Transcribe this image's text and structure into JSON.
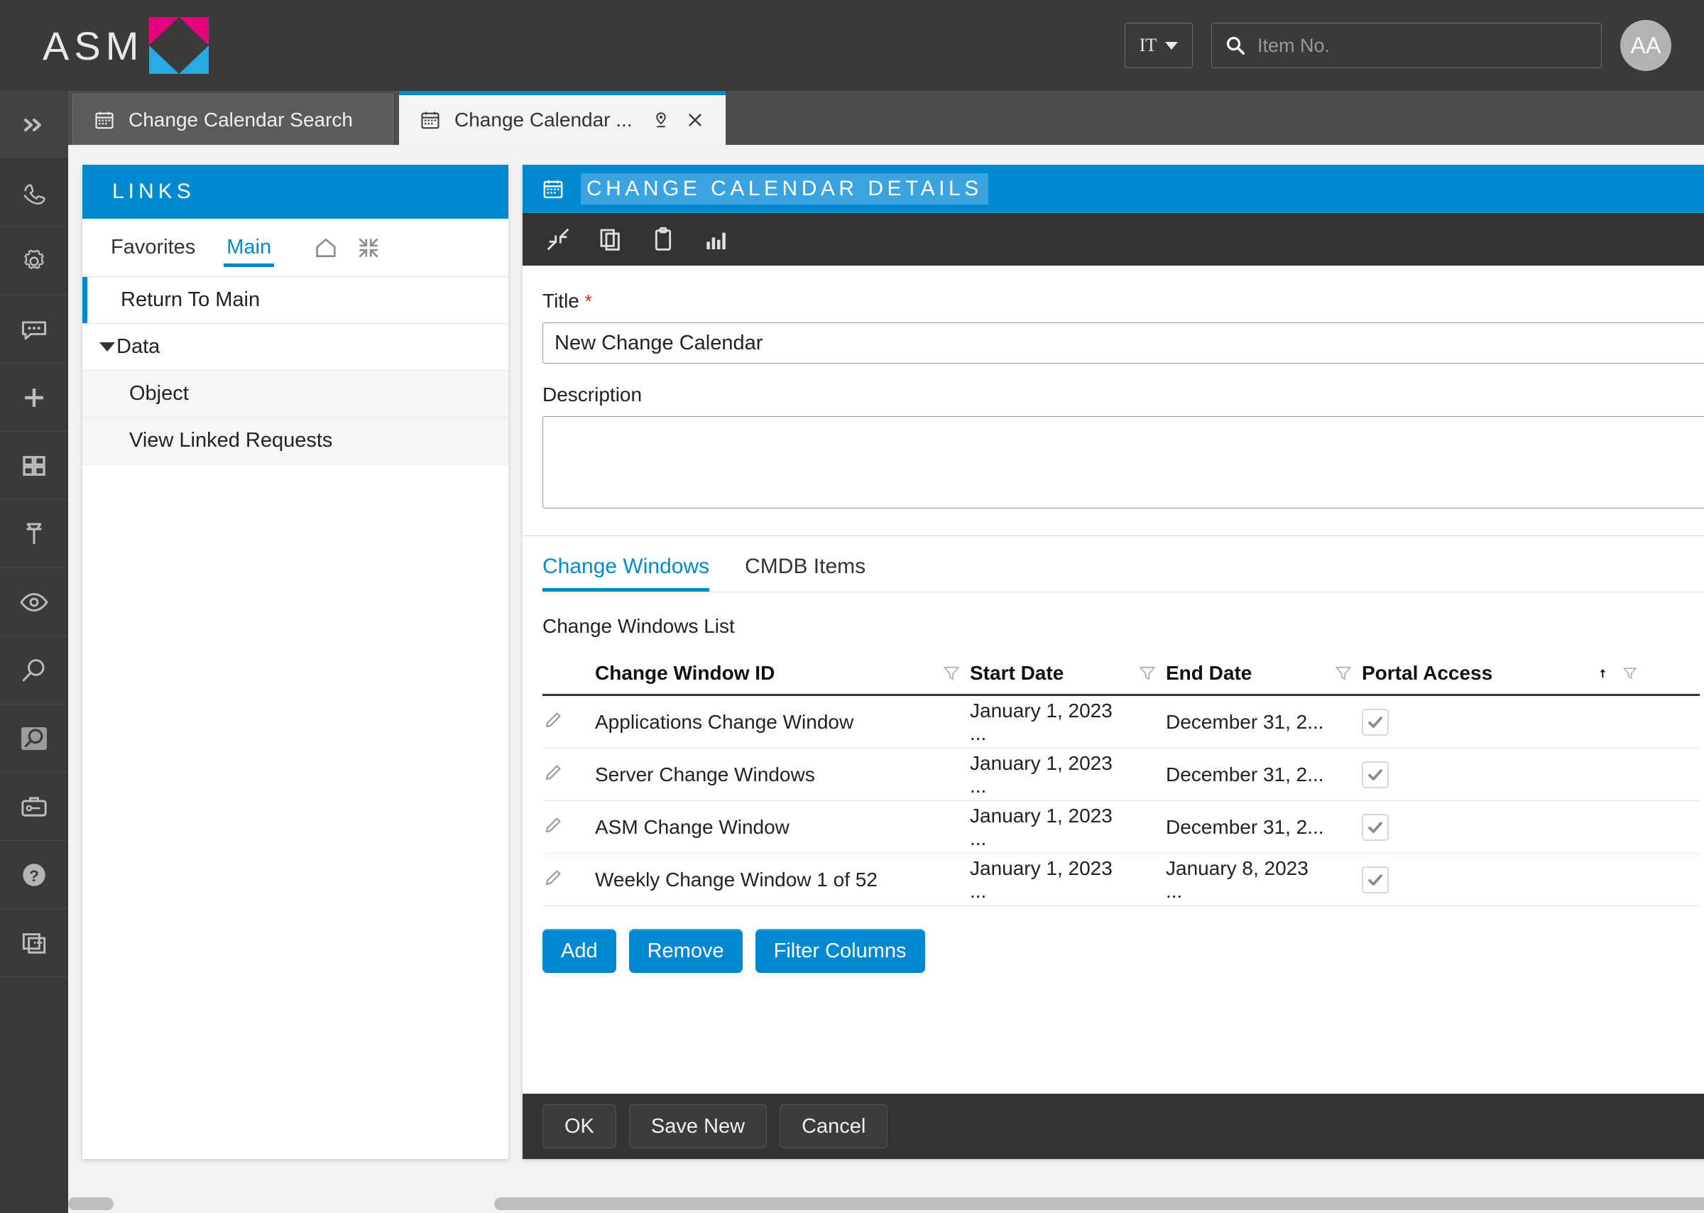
{
  "header": {
    "brand": "ASM",
    "brand_x_icon": "x-logo-icon",
    "dept_value": "IT",
    "search_placeholder": "Item No.",
    "search_value": "",
    "avatar_initials": "AA",
    "accent_color": "#0089d0",
    "brand_pink": "#e5007d",
    "brand_blue": "#29abe2"
  },
  "icon_rail": [
    {
      "name": "expand-chevrons-icon",
      "label": "Expand"
    },
    {
      "name": "phone-icon",
      "label": "Phone"
    },
    {
      "name": "gear-icon",
      "label": "Settings"
    },
    {
      "name": "chat-icon",
      "label": "Chat"
    },
    {
      "name": "plus-icon",
      "label": "New"
    },
    {
      "name": "grid-icon",
      "label": "Dashboard"
    },
    {
      "name": "pin-icon",
      "label": "Pinned"
    },
    {
      "name": "eye-icon",
      "label": "Watch"
    },
    {
      "name": "search-icon",
      "label": "Search"
    },
    {
      "name": "search-box-icon",
      "label": "Advanced Search"
    },
    {
      "name": "toolbox-icon",
      "label": "Tools"
    },
    {
      "name": "help-icon",
      "label": "Help"
    },
    {
      "name": "windows-icon",
      "label": "Windows"
    }
  ],
  "tabs": [
    {
      "label": "Change Calendar Search",
      "icon": "calendar-icon",
      "active": false
    },
    {
      "label": "Change Calendar ...",
      "icon": "calendar-icon",
      "active": true,
      "pin_icon": "location-pin-icon",
      "close_icon": "close-icon"
    }
  ],
  "links": {
    "title": "LINKS",
    "tabs": [
      {
        "label": "Favorites",
        "active": false
      },
      {
        "label": "Main",
        "active": true
      }
    ],
    "tab_icons": [
      {
        "name": "home-icon"
      },
      {
        "name": "collapse-icon"
      }
    ],
    "items": [
      {
        "label": "Return To Main",
        "type": "selected"
      },
      {
        "label": "Data",
        "type": "group"
      },
      {
        "label": "Object",
        "type": "child"
      },
      {
        "label": "View Linked Requests",
        "type": "child"
      }
    ]
  },
  "detail": {
    "title": "CHANGE CALENDAR DETAILS",
    "title_icon": "calendar-icon",
    "toolbar_icons": [
      {
        "name": "collapse-arrows-icon"
      },
      {
        "name": "copy-icon"
      },
      {
        "name": "clipboard-icon"
      },
      {
        "name": "chart-icon"
      }
    ],
    "fields": {
      "title_label": "Title",
      "title_required": "*",
      "title_value": "New Change Calendar",
      "description_label": "Description",
      "description_value": ""
    },
    "content_tabs": [
      {
        "label": "Change Windows",
        "active": true
      },
      {
        "label": "CMDB Items",
        "active": false
      }
    ],
    "list_caption": "Change Windows List",
    "table": {
      "columns": [
        "Change Window ID",
        "Start Date",
        "End Date",
        "Portal Access"
      ],
      "filter_icon": "filter-icon",
      "sort_icon": "sort-asc-icon",
      "edit_icon": "pencil-icon",
      "rows": [
        {
          "id": "Applications Change Window",
          "start": "January 1, 2023 ...",
          "end": "December 31, 2...",
          "portal_access": true
        },
        {
          "id": "Server Change Windows",
          "start": "January 1, 2023 ...",
          "end": "December 31, 2...",
          "portal_access": true
        },
        {
          "id": "ASM Change Window",
          "start": "January 1, 2023 ...",
          "end": "December 31, 2...",
          "portal_access": true
        },
        {
          "id": "Weekly Change Window 1 of 52",
          "start": "January 1, 2023 ...",
          "end": "January 8, 2023 ...",
          "portal_access": true
        }
      ]
    },
    "table_buttons": [
      {
        "label": "Add"
      },
      {
        "label": "Remove"
      },
      {
        "label": "Filter Columns"
      }
    ],
    "footer_buttons": [
      {
        "label": "OK"
      },
      {
        "label": "Save New"
      },
      {
        "label": "Cancel"
      }
    ]
  }
}
